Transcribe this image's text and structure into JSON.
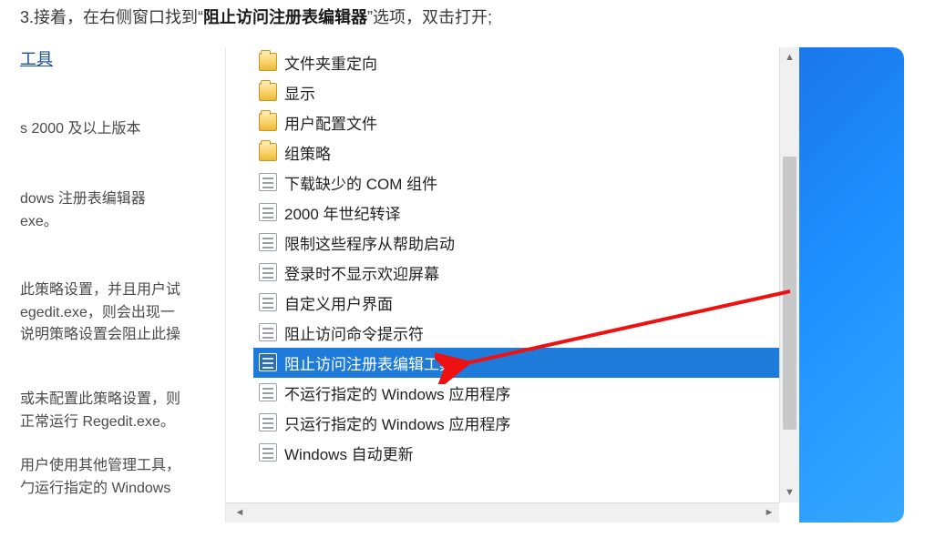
{
  "instruction": {
    "prefix": "3.接着，在右侧窗口找到“",
    "bold": "阻止访问注册表编辑器",
    "suffix": "”选项，双击打开;"
  },
  "left_panel": {
    "link_fragment": "工具",
    "line1": "s 2000 及以上版本",
    "line2a": "dows 注册表编辑器",
    "line2b": "exe。",
    "line3a": "此策略设置，并且用户试",
    "line3b": "egedit.exe，则会出现一",
    "line3c": "说明策略设置会阻止此操",
    "line4a": "或未配置此策略设置，则",
    "line4b": "正常运行 Regedit.exe。",
    "line5a": "用户使用其他管理工具，",
    "line5b": "勹运行指定的 Windows"
  },
  "gp_items": [
    {
      "type": "folder",
      "label": "文件夹重定向"
    },
    {
      "type": "folder",
      "label": "显示"
    },
    {
      "type": "folder",
      "label": "用户配置文件"
    },
    {
      "type": "folder",
      "label": "组策略"
    },
    {
      "type": "setting",
      "label": "下载缺少的 COM 组件"
    },
    {
      "type": "setting",
      "label": "2000 年世纪转译"
    },
    {
      "type": "setting",
      "label": "限制这些程序从帮助启动"
    },
    {
      "type": "setting",
      "label": "登录时不显示欢迎屏幕"
    },
    {
      "type": "setting",
      "label": "自定义用户界面"
    },
    {
      "type": "setting",
      "label": "阻止访问命令提示符"
    },
    {
      "type": "setting",
      "label": "阻止访问注册表编辑工具",
      "selected": true
    },
    {
      "type": "setting",
      "label": "不运行指定的 Windows 应用程序"
    },
    {
      "type": "setting",
      "label": "只运行指定的 Windows 应用程序"
    },
    {
      "type": "setting",
      "label": "Windows 自动更新"
    }
  ]
}
